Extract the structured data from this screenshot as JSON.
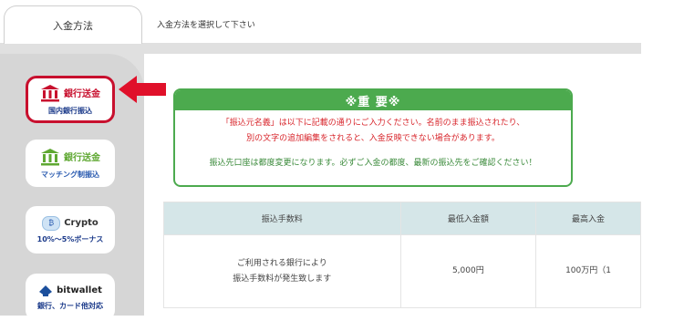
{
  "tabs": {
    "active_label": "入金方法",
    "hint": "入金方法を選択して下さい"
  },
  "methods": [
    {
      "name": "銀行送金",
      "sub": "国内銀行振込",
      "icon": "bank-icon",
      "color": "#c8102e"
    },
    {
      "name": "銀行送金",
      "sub": "マッチング制振込",
      "icon": "bank-icon",
      "color": "#5fa832"
    },
    {
      "name": "Crypto",
      "sub": "10%〜5%ボーナス",
      "icon": "coin-icon"
    },
    {
      "name": "bitwallet",
      "sub": "銀行、カード他対応",
      "icon": "wallet-icon"
    }
  ],
  "notice": {
    "title": "※重 要※",
    "line1": "「振込元名義」は以下に記載の通りにご入力ください。名前のまま振込されたり、",
    "line2": "別の文字の追加編集をされると、入金反映できない場合があります。",
    "line3": "振込先口座は都度変更になります。必ずご入金の都度、最新の振込先をご確認ください！"
  },
  "fee_table": {
    "headers": [
      "振込手数料",
      "最低入金額",
      "最高入金"
    ],
    "row": {
      "fee_line1": "ご利用される銀行により",
      "fee_line2": "振込手数料が発生致します",
      "min": "5,000円",
      "max": "100万円（1"
    }
  },
  "colors": {
    "accent_red": "#c8102e",
    "notice_green": "#4caa4e",
    "table_header": "#d5e6e8"
  }
}
